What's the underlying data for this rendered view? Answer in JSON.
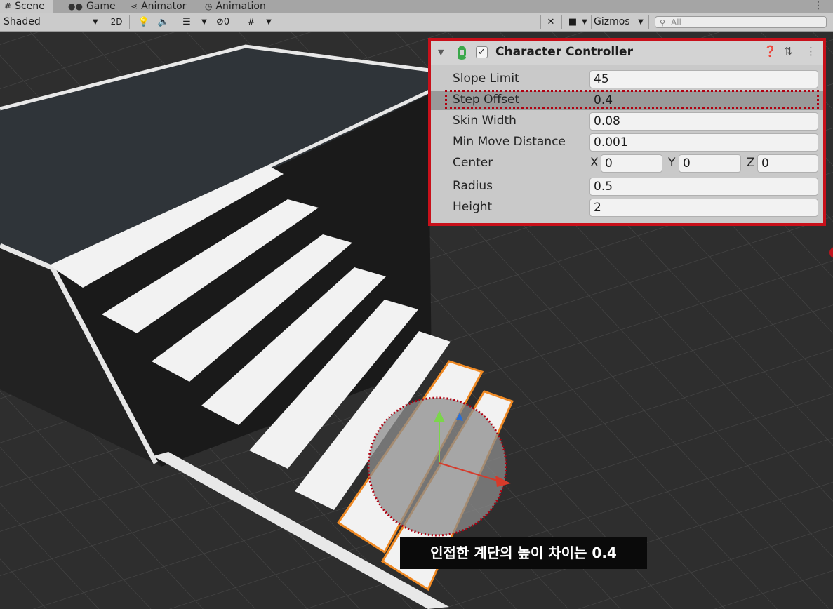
{
  "tabs": [
    {
      "label": "Scene",
      "icon": "hash-icon"
    },
    {
      "label": "Game",
      "icon": "gamepad-icon"
    },
    {
      "label": "Animator",
      "icon": "animator-icon"
    },
    {
      "label": "Animation",
      "icon": "clock-icon"
    }
  ],
  "toolbar": {
    "shading_mode": "Shaded",
    "mode_2d": "2D",
    "hidden_count": "0",
    "gizmos": "Gizmos",
    "search_placeholder": "All"
  },
  "inspector": {
    "component_title": "Character Controller",
    "enabled": true,
    "fields": {
      "slope_limit": {
        "label": "Slope Limit",
        "value": "45"
      },
      "step_offset": {
        "label": "Step Offset",
        "value": "0.4"
      },
      "skin_width": {
        "label": "Skin Width",
        "value": "0.08"
      },
      "min_move_distance": {
        "label": "Min Move Distance",
        "value": "0.001"
      },
      "center": {
        "label": "Center",
        "x_label": "X",
        "x": "0",
        "y_label": "Y",
        "y": "0",
        "z_label": "Z",
        "z": "0"
      },
      "radius": {
        "label": "Radius",
        "value": "0.5"
      },
      "height": {
        "label": "Height",
        "value": "2"
      }
    }
  },
  "caption": "인접한 계단의 높이 차이는 0.4",
  "colors": {
    "highlight_border": "#c8101a",
    "selection_outline": "#f08a24",
    "annotation_dots": "#b00010"
  }
}
